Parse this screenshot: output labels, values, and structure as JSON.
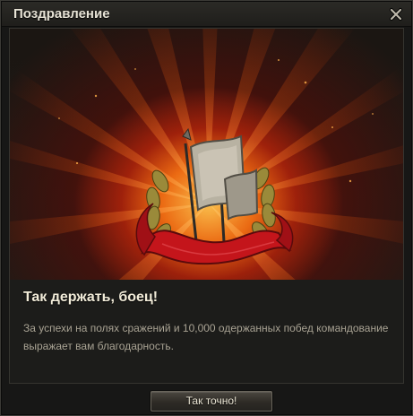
{
  "window": {
    "title": "Поздравление",
    "close_icon": "close-icon"
  },
  "banner": {
    "emblem_icon": "victory-banner-laurel-emblem"
  },
  "message": {
    "heading": "Так держать, боец!",
    "body": "За успехи на полях сражений и 10,000 одержанных побед командование выражает вам благодарность."
  },
  "footer": {
    "ok_label": "Так точно!"
  },
  "colors": {
    "accent_glow": "#ff7a14",
    "ribbon_red": "#c4151b",
    "laurel_gold": "#c8a24a"
  }
}
